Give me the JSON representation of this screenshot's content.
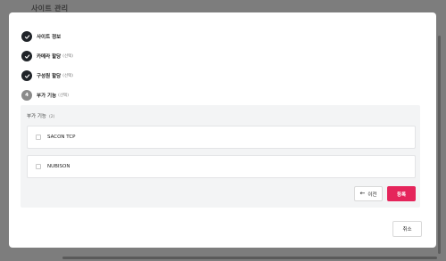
{
  "background": {
    "title": "사이트 관리"
  },
  "steps": [
    {
      "label": "사이트 정보",
      "optional": "",
      "status": "done",
      "icon": "check-icon"
    },
    {
      "label": "카메라 할당",
      "optional": "(선택)",
      "status": "done",
      "icon": "check-icon"
    },
    {
      "label": "구성원 할당",
      "optional": "(선택)",
      "status": "done",
      "icon": "check-icon"
    },
    {
      "label": "부가 기능",
      "optional": "(선택)",
      "status": "current",
      "number": "4"
    }
  ],
  "panel": {
    "title": "부가 기능",
    "count": "(2)",
    "options": [
      {
        "label": "SACON TCP",
        "checked": false
      },
      {
        "label": "NUBISON",
        "checked": false
      }
    ]
  },
  "buttons": {
    "prev_label": "이전",
    "prev_icon": "arrow-left-icon",
    "register_label": "등록",
    "cancel_label": "취소"
  },
  "colors": {
    "accent": "#e5255b",
    "step_done": "#1f2328",
    "step_pending": "#8a8a8a"
  }
}
